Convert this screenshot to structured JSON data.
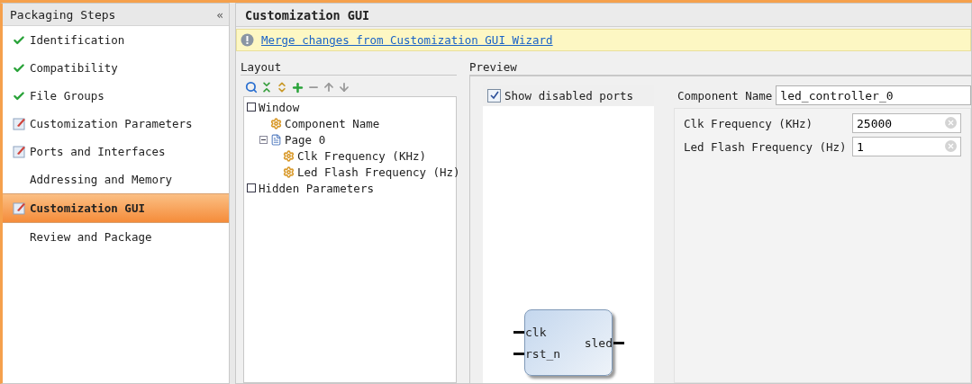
{
  "sidebar": {
    "title": "Packaging Steps",
    "collapse": "«",
    "items": [
      {
        "label": "Identification",
        "kind": "done",
        "selected": false
      },
      {
        "label": "Compatibility",
        "kind": "done",
        "selected": false
      },
      {
        "label": "File Groups",
        "kind": "done",
        "selected": false
      },
      {
        "label": "Customization Parameters",
        "kind": "edited",
        "selected": false
      },
      {
        "label": "Ports and Interfaces",
        "kind": "edited",
        "selected": false
      },
      {
        "label": "Addressing and Memory",
        "kind": "plain",
        "selected": false
      },
      {
        "label": "Customization GUI",
        "kind": "edited",
        "selected": true
      },
      {
        "label": "Review and Package",
        "kind": "plain",
        "selected": false
      }
    ]
  },
  "header": {
    "title": "Customization GUI"
  },
  "notice": {
    "link": "Merge changes from Customization GUI Wizard"
  },
  "layout": {
    "label": "Layout",
    "tree": [
      {
        "label": "Window",
        "kind": "window",
        "children": [
          {
            "label": "Component Name",
            "kind": "param"
          },
          {
            "label": "Page 0",
            "kind": "page",
            "expanded": true,
            "children": [
              {
                "label": "Clk Frequency (KHz)",
                "kind": "param"
              },
              {
                "label": "Led Flash Frequency (Hz)",
                "kind": "param"
              }
            ]
          }
        ]
      },
      {
        "label": "Hidden Parameters",
        "kind": "window"
      }
    ]
  },
  "preview": {
    "label": "Preview",
    "show_disabled": {
      "label": "Show disabled ports",
      "checked": true
    },
    "symbol": {
      "inputs": [
        "clk",
        "rst_n"
      ],
      "outputs": [
        "sled"
      ]
    },
    "component_name": {
      "label": "Component Name",
      "value": "led_controller_0"
    },
    "params": [
      {
        "label": "Clk Frequency (KHz)",
        "value": "25000"
      },
      {
        "label": "Led Flash Frequency (Hz)",
        "value": "1"
      }
    ]
  }
}
